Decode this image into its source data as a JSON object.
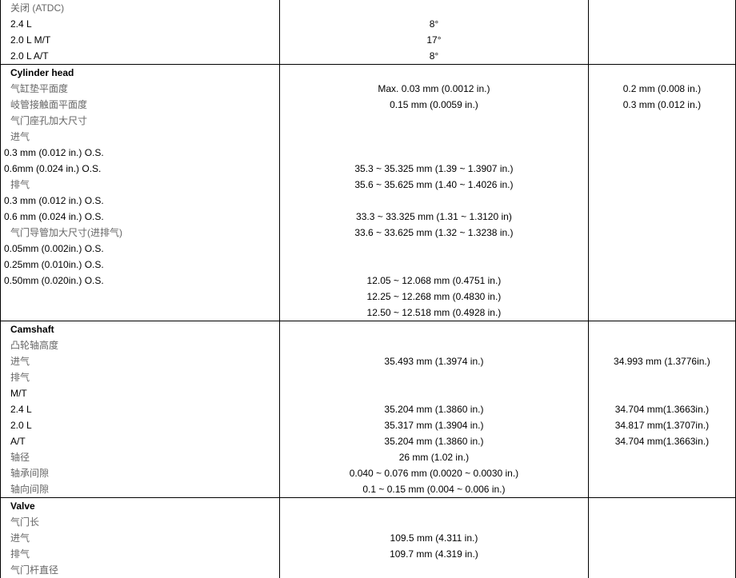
{
  "sections": [
    {
      "rows": [
        {
          "c1": "关闭  (ATDC)",
          "c2": "",
          "c3": "",
          "c1cls": "lbl"
        },
        {
          "c1": "2.4 L",
          "c2": "8°",
          "c3": ""
        },
        {
          "c1": "2.0 L M/T",
          "c2": "17°",
          "c3": ""
        },
        {
          "c1": "2.0 L A/T",
          "c2": "8°",
          "c3": ""
        }
      ]
    },
    {
      "rows": [
        {
          "c1": "Cylinder head",
          "c2": "",
          "c3": "",
          "c1cls": "bold"
        },
        {
          "c1": "气缸垫平面度",
          "c2": "Max. 0.03 mm (0.0012 in.)",
          "c3": "0.2 mm (0.008 in.)",
          "c1cls": "lbl"
        },
        {
          "c1": "岐管接触面平面度",
          "c2": "0.15 mm (0.0059 in.)",
          "c3": "0.3 mm (0.012 in.)",
          "c1cls": "lbl"
        },
        {
          "c1": "气门座孔加大尺寸",
          "c2": "",
          "c3": "",
          "c1cls": "lbl"
        },
        {
          "c1": "进气",
          "c2": "",
          "c3": "",
          "c1cls": "lbl"
        },
        {
          "c1": "0.3 mm (0.012 in.) O.S.",
          "c2": "",
          "c3": "",
          "out": true
        },
        {
          "c1": "0.6mm (0.024 in.) O.S.",
          "c2": "35.3 ~ 35.325 mm (1.39 ~ 1.3907 in.)",
          "c3": "",
          "out": true
        },
        {
          "c1": "排气",
          "c2": "35.6 ~ 35.625 mm (1.40 ~ 1.4026 in.)",
          "c3": "",
          "c1cls": "lbl"
        },
        {
          "c1": "0.3 mm (0.012 in.) O.S.",
          "c2": "",
          "c3": "",
          "out": true
        },
        {
          "c1": "0.6 mm (0.024 in.) O.S.",
          "c2": "33.3 ~ 33.325 mm (1.31 ~ 1.3120 in)",
          "c3": "",
          "out": true
        },
        {
          "c1": "气门导管加大尺寸(进排气)",
          "c2": "33.6 ~ 33.625 mm (1.32 ~ 1.3238 in.)",
          "c3": "",
          "c1cls": "lbl"
        },
        {
          "c1": "0.05mm (0.002in.) O.S.",
          "c2": "",
          "c3": "",
          "out": true
        },
        {
          "c1": "0.25mm (0.010in.) O.S.",
          "c2": "",
          "c3": "",
          "out": true
        },
        {
          "c1": "0.50mm (0.020in.) O.S.",
          "c2": "12.05 ~ 12.068 mm (0.4751 in.)",
          "c3": "",
          "out": true
        },
        {
          "c1": "",
          "c2": "12.25 ~ 12.268 mm (0.4830 in.)",
          "c3": ""
        },
        {
          "c1": "",
          "c2": "12.50 ~ 12.518 mm (0.4928 in.)",
          "c3": ""
        }
      ]
    },
    {
      "rows": [
        {
          "c1": "Camshaft",
          "c2": "",
          "c3": "",
          "c1cls": "bold"
        },
        {
          "c1": "凸轮轴高度",
          "c2": "",
          "c3": "",
          "c1cls": "lbl"
        },
        {
          "c1": "进气",
          "c2": "35.493 mm (1.3974 in.)",
          "c3": "34.993 mm (1.3776in.)",
          "c1cls": "lbl"
        },
        {
          "c1": "排气",
          "c2": "",
          "c3": "",
          "c1cls": "lbl"
        },
        {
          "c1": "M/T",
          "c2": "",
          "c3": ""
        },
        {
          "c1": "2.4 L",
          "c2": "35.204 mm (1.3860 in.)",
          "c3": "34.704 mm(1.3663in.)"
        },
        {
          "c1": "2.0 L",
          "c2": "35.317 mm (1.3904 in.)",
          "c3": "34.817 mm(1.3707in.)"
        },
        {
          "c1": "A/T",
          "c2": "35.204 mm (1.3860 in.)",
          "c3": "34.704 mm(1.3663in.)"
        },
        {
          "c1": "轴径",
          "c2": "26 mm (1.02 in.)",
          "c3": "",
          "c1cls": "lbl"
        },
        {
          "c1": "轴承间隙",
          "c2": "0.040 ~ 0.076 mm (0.0020 ~ 0.0030 in.)",
          "c3": "",
          "c1cls": "lbl"
        },
        {
          "c1": "轴向间隙",
          "c2": "0.1 ~ 0.15 mm (0.004 ~ 0.006 in.)",
          "c3": "",
          "c1cls": "lbl"
        }
      ]
    },
    {
      "rows": [
        {
          "c1": "Valve",
          "c2": "",
          "c3": "",
          "c1cls": "bold"
        },
        {
          "c1": "气门长",
          "c2": "",
          "c3": "",
          "c1cls": "lbl"
        },
        {
          "c1": "进气",
          "c2": "109.5 mm (4.311 in.)",
          "c3": "",
          "c1cls": "lbl"
        },
        {
          "c1": "排气",
          "c2": "109.7 mm (4.319 in.)",
          "c3": "",
          "c1cls": "lbl"
        },
        {
          "c1": "气门杆直径",
          "c2": "",
          "c3": "",
          "c1cls": "lbl"
        }
      ],
      "noBottom": true
    }
  ]
}
